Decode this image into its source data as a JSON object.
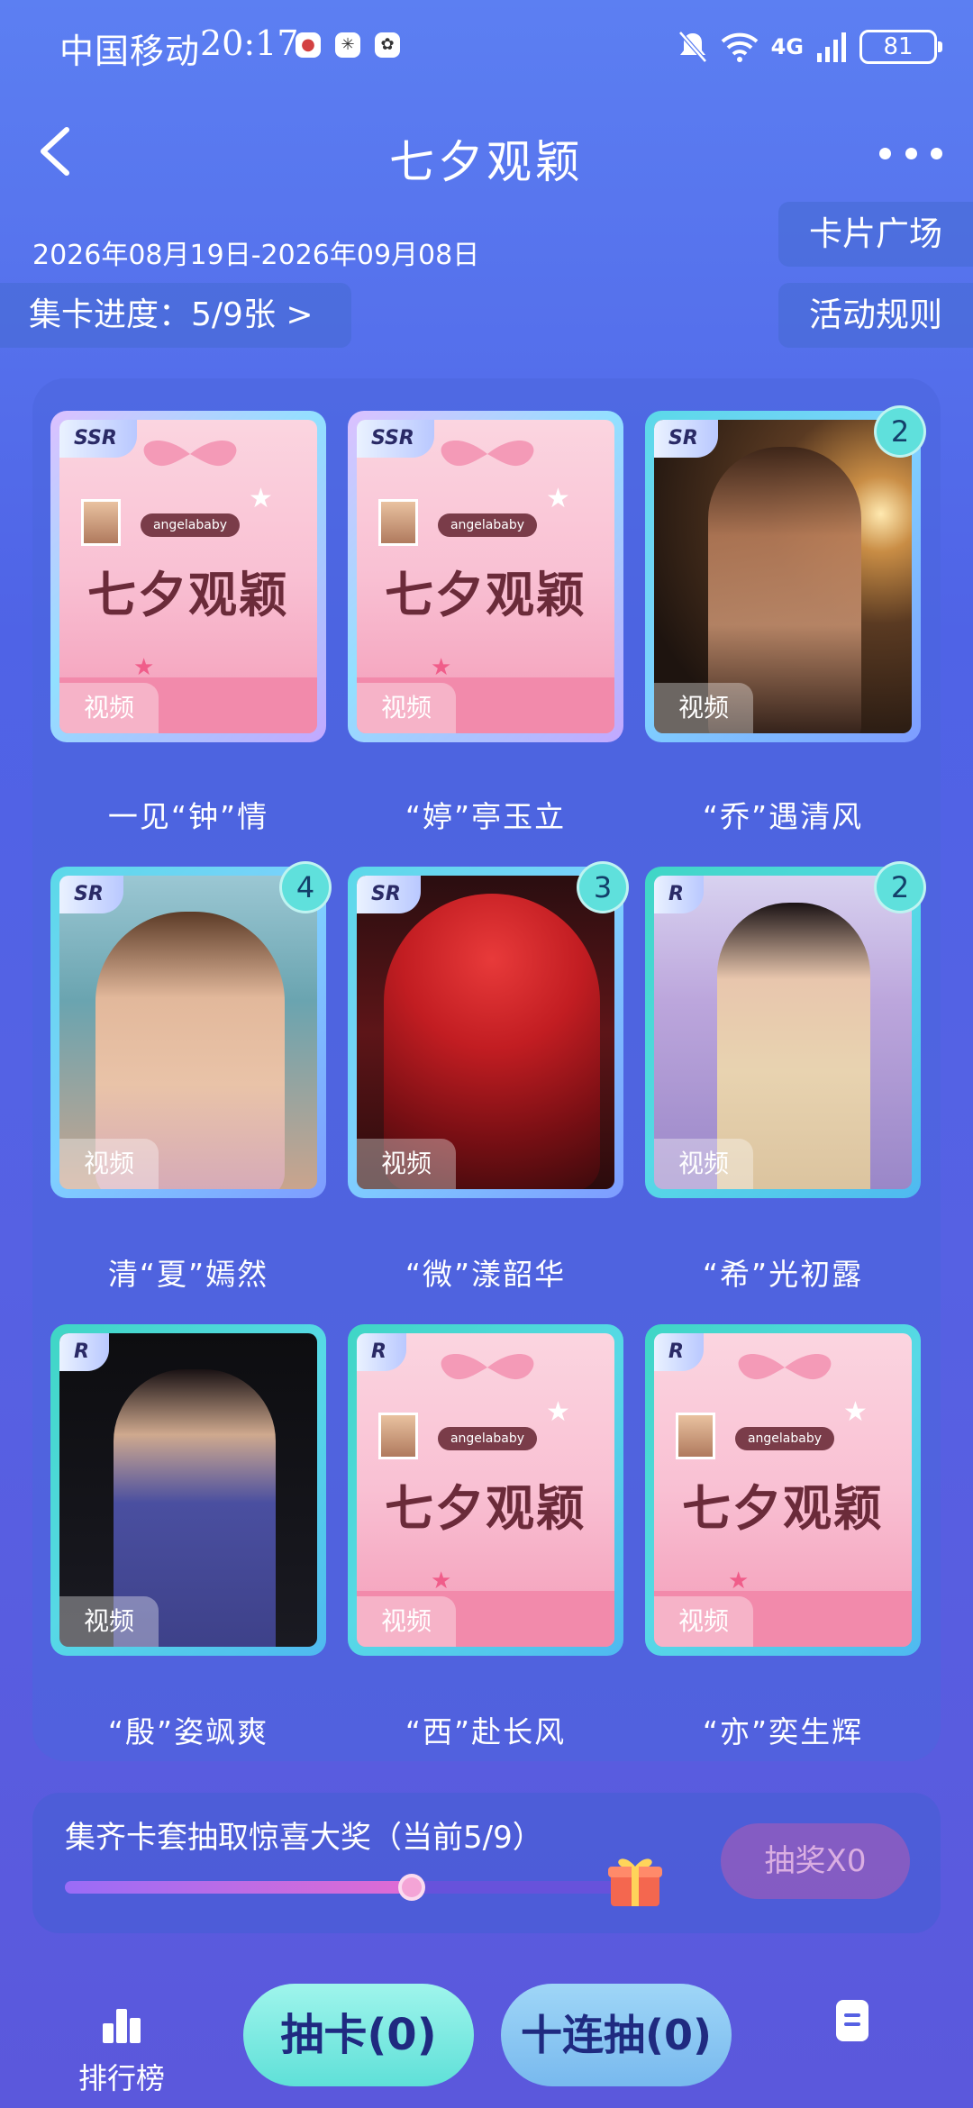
{
  "status_bar": {
    "carrier": "中国移动",
    "time": "20:17",
    "network": "4G",
    "battery": "81"
  },
  "header": {
    "title": "七夕观颖",
    "back_icon": "back-arrow-icon",
    "more_icon": "more-dots-icon"
  },
  "event": {
    "date_range": "2026年08月19日-2026年09月08日",
    "progress_label": "集卡进度：5/9张 >",
    "card_plaza": "卡片广场",
    "rules": "活动规则"
  },
  "cards": [
    {
      "rarity": "SSR",
      "tag": "视频",
      "name": "一见“钟”情"
    },
    {
      "rarity": "SSR",
      "tag": "视频",
      "name": "“婷”亭玉立"
    },
    {
      "rarity": "SR",
      "tag": "视频",
      "name": "“乔”遇清风",
      "count": "2"
    },
    {
      "rarity": "SR",
      "tag": "视频",
      "name": "清“夏”嫣然",
      "count": "4"
    },
    {
      "rarity": "SR",
      "tag": "视频",
      "name": "“微”漾韶华",
      "count": "3"
    },
    {
      "rarity": "R",
      "tag": "视频",
      "name": "“希”光初露",
      "count": "2"
    },
    {
      "rarity": "R",
      "tag": "视频",
      "name": "“殷”姿飒爽"
    },
    {
      "rarity": "R",
      "tag": "视频",
      "name": "“西”赴长风"
    },
    {
      "rarity": "R",
      "tag": "视频",
      "name": "“亦”奕生辉"
    }
  ],
  "poster": {
    "title": "七夕观颖",
    "subtitle": "angelababy"
  },
  "lottery": {
    "title": "集齐卡套抽取惊喜大奖（当前5/9）",
    "progress": 0.556,
    "draw_button": "抽奖X0"
  },
  "bottom": {
    "rank": "排行榜",
    "draw": "抽卡(0)",
    "ten_draw": "十连抽(0)"
  },
  "colors": {
    "background": "#5661e3",
    "accent_teal": "#5fe0d8",
    "accent_pink": "#f39bb7"
  }
}
